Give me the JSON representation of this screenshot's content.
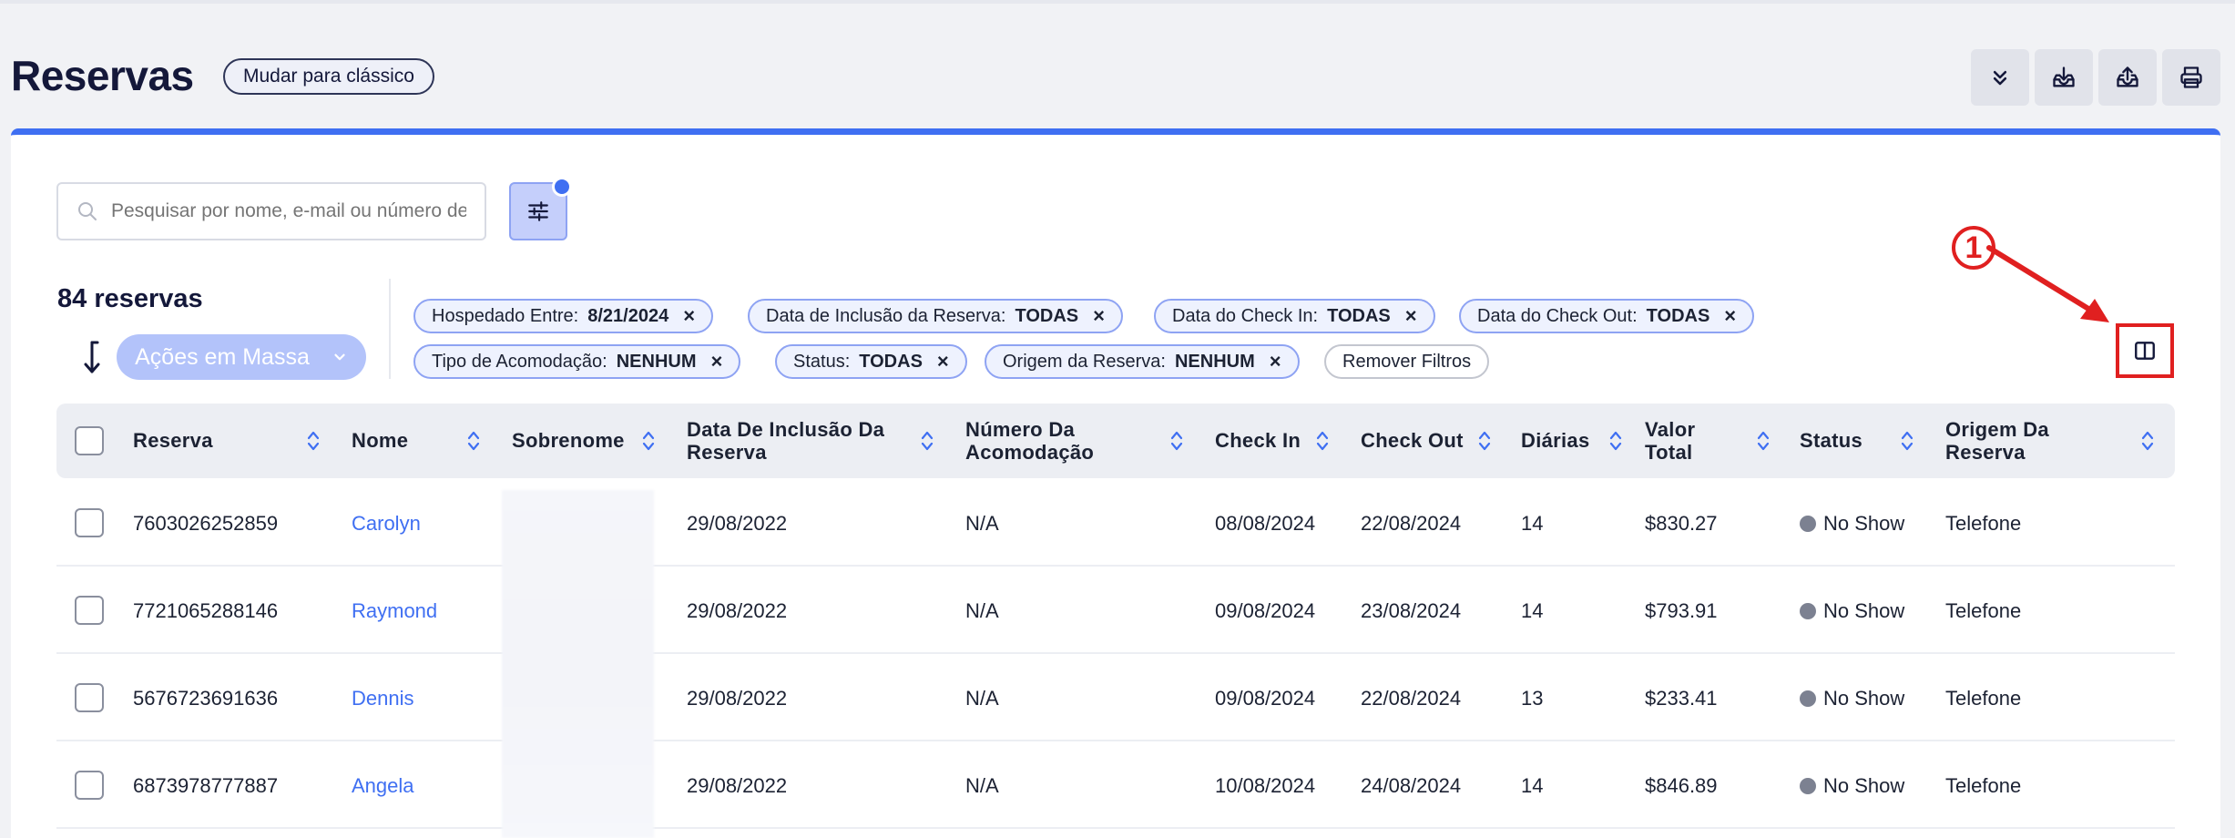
{
  "header": {
    "title": "Reservas",
    "switch_label": "Mudar para clássico"
  },
  "toolbar": {
    "icons": [
      "chevrons-down-icon",
      "download-icon",
      "upload-icon",
      "printer-icon"
    ]
  },
  "search": {
    "placeholder": "Pesquisar por nome, e-mail ou número de reserva"
  },
  "summary": {
    "count": "84 reservas",
    "bulk_label": "Ações em Massa"
  },
  "filters": [
    {
      "label": "Hospedado Entre:",
      "value": "8/21/2024"
    },
    {
      "label": "Data de Inclusão da Reserva:",
      "value": "TODAS"
    },
    {
      "label": "Data do Check In:",
      "value": "TODAS"
    },
    {
      "label": "Data do Check Out:",
      "value": "TODAS"
    },
    {
      "label": "Tipo de Acomodação:",
      "value": "NENHUM"
    },
    {
      "label": "Status:",
      "value": "TODAS"
    },
    {
      "label": "Origem da Reserva:",
      "value": "NENHUM"
    }
  ],
  "remove_filters": "Remover Filtros",
  "annotation": {
    "number": "1"
  },
  "table": {
    "columns": [
      {
        "line1": "Reserva",
        "line2": ""
      },
      {
        "line1": "Nome",
        "line2": ""
      },
      {
        "line1": "Sobrenome",
        "line2": ""
      },
      {
        "line1": "Data De Inclusão Da",
        "line2": "Reserva"
      },
      {
        "line1": "Número Da",
        "line2": "Acomodação"
      },
      {
        "line1": "Check In",
        "line2": ""
      },
      {
        "line1": "Check Out",
        "line2": ""
      },
      {
        "line1": "Diárias",
        "line2": ""
      },
      {
        "line1": "Valor",
        "line2": "Total"
      },
      {
        "line1": "Status",
        "line2": ""
      },
      {
        "line1": "Origem Da",
        "line2": "Reserva"
      }
    ],
    "rows": [
      {
        "reserva": "7603026252859",
        "nome": "Carolyn",
        "sobrenome": "",
        "inclusao": "29/08/2022",
        "acomodacao": "N/A",
        "checkin": "08/08/2024",
        "checkout": "22/08/2024",
        "diarias": "14",
        "valor": "$830.27",
        "status": "No Show",
        "origem": "Telefone"
      },
      {
        "reserva": "7721065288146",
        "nome": "Raymond",
        "sobrenome": "",
        "inclusao": "29/08/2022",
        "acomodacao": "N/A",
        "checkin": "09/08/2024",
        "checkout": "23/08/2024",
        "diarias": "14",
        "valor": "$793.91",
        "status": "No Show",
        "origem": "Telefone"
      },
      {
        "reserva": "5676723691636",
        "nome": "Dennis",
        "sobrenome": "",
        "inclusao": "29/08/2022",
        "acomodacao": "N/A",
        "checkin": "09/08/2024",
        "checkout": "22/08/2024",
        "diarias": "13",
        "valor": "$233.41",
        "status": "No Show",
        "origem": "Telefone"
      },
      {
        "reserva": "6873978777887",
        "nome": "Angela",
        "sobrenome": "",
        "inclusao": "29/08/2022",
        "acomodacao": "N/A",
        "checkin": "10/08/2024",
        "checkout": "24/08/2024",
        "diarias": "14",
        "valor": "$846.89",
        "status": "No Show",
        "origem": "Telefone"
      }
    ]
  }
}
